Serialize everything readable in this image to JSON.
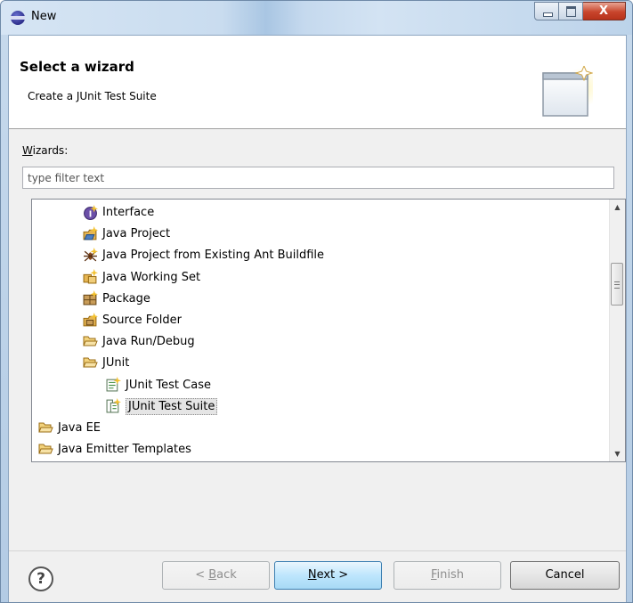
{
  "window": {
    "title": "New",
    "controls": {
      "minimize": "minimize",
      "maximize": "maximize",
      "close": "X"
    }
  },
  "banner": {
    "title": "Select a wizard",
    "description": "Create a JUnit Test Suite"
  },
  "wizards": {
    "label_first": "W",
    "label_rest": "izards:",
    "filter_placeholder": "type filter text"
  },
  "tree": {
    "items": [
      {
        "label": "Interface",
        "icon": "interface-icon",
        "indent": 2
      },
      {
        "label": "Java Project",
        "icon": "java-project-icon",
        "indent": 2
      },
      {
        "label": "Java Project from Existing Ant Buildfile",
        "icon": "ant-buildfile-icon",
        "indent": 2
      },
      {
        "label": "Java Working Set",
        "icon": "working-set-icon",
        "indent": 2
      },
      {
        "label": "Package",
        "icon": "package-icon",
        "indent": 2
      },
      {
        "label": "Source Folder",
        "icon": "source-folder-icon",
        "indent": 2
      },
      {
        "label": "Java Run/Debug",
        "icon": "folder-open-icon",
        "indent": 2
      },
      {
        "label": "JUnit",
        "icon": "folder-open-icon",
        "indent": 2
      },
      {
        "label": "JUnit Test Case",
        "icon": "junit-test-case-icon",
        "indent": 3
      },
      {
        "label": "JUnit Test Suite",
        "icon": "junit-test-suite-icon",
        "indent": 3,
        "selected": true
      },
      {
        "label": "Java EE",
        "icon": "folder-open-icon",
        "indent": 1
      },
      {
        "label": "Java Emitter Templates",
        "icon": "folder-open-icon",
        "indent": 1
      }
    ],
    "scroll_up": "▲",
    "scroll_down": "▼"
  },
  "buttons": {
    "help": "?",
    "back_prefix": "< ",
    "back_u": "B",
    "back_rest": "ack",
    "next_u": "N",
    "next_rest": "ext >",
    "finish_u": "F",
    "finish_rest": "inish",
    "cancel": "Cancel"
  }
}
